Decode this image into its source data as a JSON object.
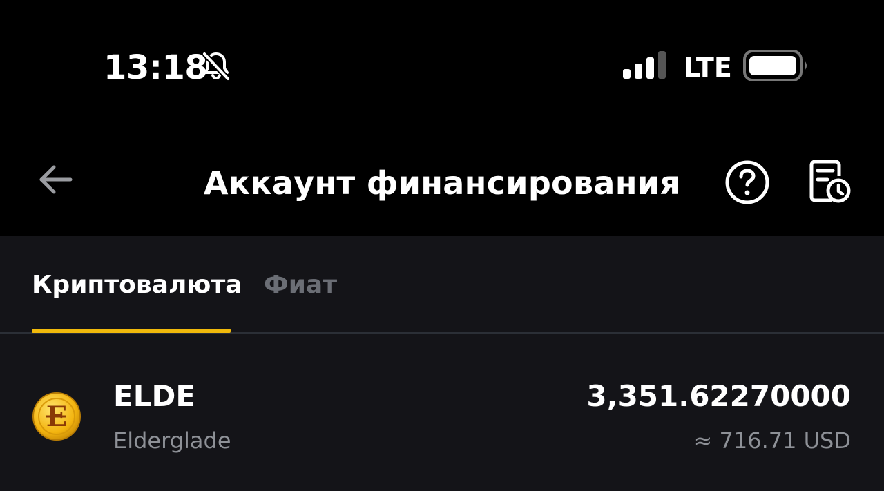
{
  "status_bar": {
    "time": "13:18",
    "network": "LTE",
    "icons": [
      "bell-slash-icon",
      "signal-bars-icon",
      "battery-icon"
    ]
  },
  "header": {
    "title": "Аккаунт финансирования",
    "icons": [
      "back-arrow-icon",
      "help-icon",
      "history-icon"
    ]
  },
  "tabs": [
    {
      "label": "Криптовалюта",
      "active": true
    },
    {
      "label": "Фиат",
      "active": false
    }
  ],
  "assets": [
    {
      "symbol": "ELDE",
      "name": "Elderglade",
      "amount": "3,351.62270000",
      "fiat_value": "≈ 716.71 USD",
      "icon": "elderglade-coin-icon"
    }
  ],
  "colors": {
    "background": "#000000",
    "content_background": "#141418",
    "accent": "#f0b90b",
    "muted_text": "#8e9197",
    "inactive_tab": "#6b6e75"
  }
}
